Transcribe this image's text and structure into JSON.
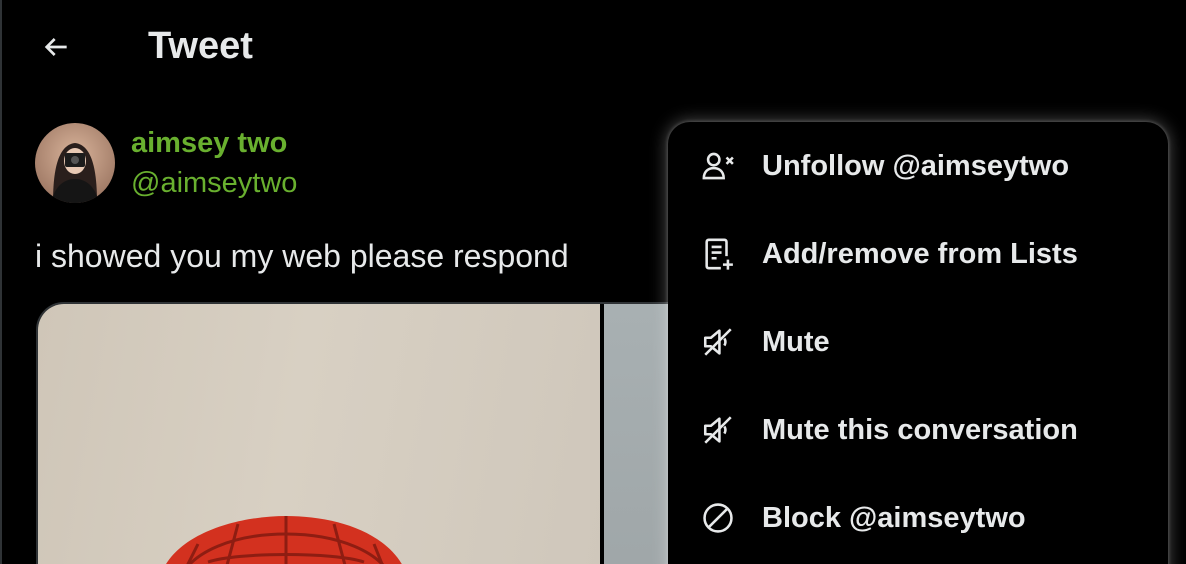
{
  "colors": {
    "background": "#000000",
    "text": "#e7e9ea",
    "author_name": "#69b02f",
    "author_handle": "#69b02f",
    "menu_shadow": "#ffffff",
    "border": "#2f3336"
  },
  "header": {
    "back_icon": "arrow-left-icon",
    "title": "Tweet"
  },
  "tweet": {
    "author": {
      "display_name": "aimsey two",
      "handle": "@aimseytwo"
    },
    "text": "i showed you my web please respond"
  },
  "menu": {
    "items": [
      {
        "label": "Unfollow @aimseytwo",
        "icon": "unfollow-user-icon"
      },
      {
        "label": "Add/remove from Lists",
        "icon": "list-add-icon"
      },
      {
        "label": "Mute",
        "icon": "speaker-mute-icon"
      },
      {
        "label": "Mute this conversation",
        "icon": "speaker-mute-icon"
      },
      {
        "label": "Block @aimseytwo",
        "icon": "block-icon"
      }
    ]
  }
}
